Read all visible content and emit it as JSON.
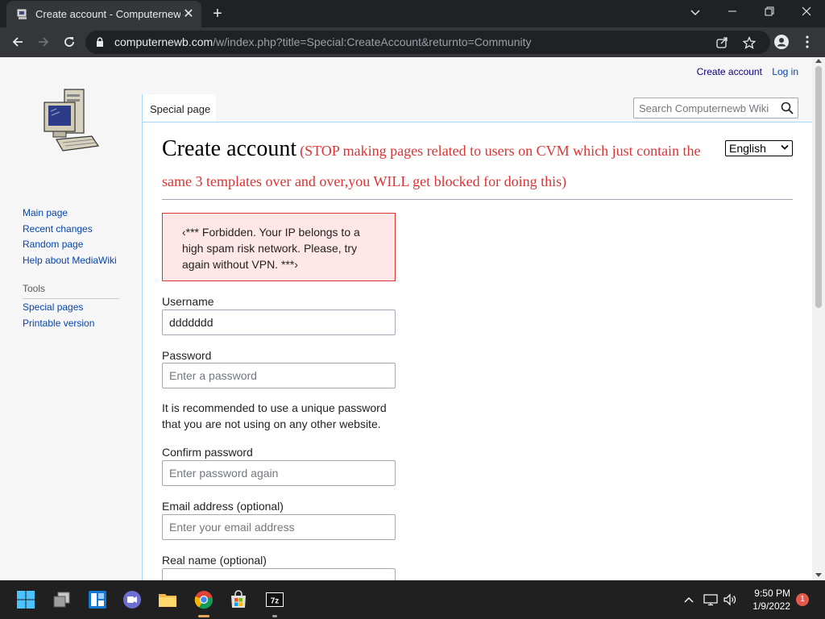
{
  "browser": {
    "tab_title": "Create account - Computernewb Wiki",
    "tab_close": "✕",
    "new_tab": "+",
    "url_host": "computernewb.com",
    "url_path": "/w/index.php?title=Special:CreateAccount&returnto=Community"
  },
  "wiki": {
    "personal_create_account": "Create account",
    "personal_login": "Log in",
    "tab_special_page": "Special page",
    "search_placeholder": "Search Computernewb Wiki",
    "sidebar": [
      "Main page",
      "Recent changes",
      "Random page",
      "Help about MediaWiki"
    ],
    "tools_heading": "Tools",
    "tools": [
      "Special pages",
      "Printable version"
    ]
  },
  "page": {
    "title": "Create account",
    "notice": "(STOP making pages related to users on CVM which just contain the same 3 templates over and over,you WILL get blocked for doing this)",
    "language": "English",
    "error": "‹*** Forbidden. Your IP belongs to a high spam risk network. Please, try again without VPN. ***›"
  },
  "form": {
    "username_label": "Username",
    "username_value": "ddddddd",
    "password_label": "Password",
    "password_placeholder": "Enter a password",
    "password_help": "It is recommended to use a unique password that you are not using on any other website.",
    "confirm_label": "Confirm password",
    "confirm_placeholder": "Enter password again",
    "email_label": "Email address (optional)",
    "email_placeholder": "Enter your email address",
    "realname_label": "Real name (optional)"
  },
  "taskbar": {
    "time": "9:50 PM",
    "date": "1/9/2022",
    "notification_count": "1"
  },
  "icons": [
    "windows-icon",
    "task-view-icon",
    "widgets-icon",
    "teams-chat-icon",
    "file-explorer-icon",
    "chrome-icon",
    "store-icon",
    "7zip-icon"
  ]
}
